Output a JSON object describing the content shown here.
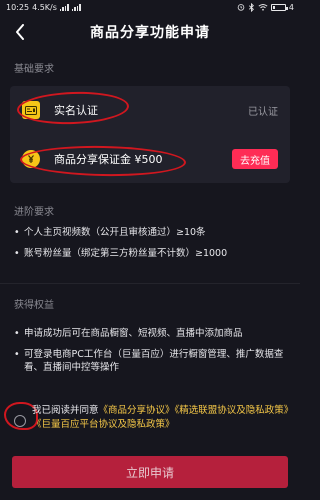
{
  "status_bar": {
    "time": "10:25",
    "network": "4.5K/s",
    "battery": "4"
  },
  "header": {
    "title": "商品分享功能申请",
    "back_icon": "chevron-left-icon"
  },
  "basic_requirements": {
    "section_label": "基础要求",
    "items": [
      {
        "label": "实名认证",
        "status": "已认证",
        "icon": "id-card-icon"
      },
      {
        "label": "商品分享保证金 ¥500",
        "action": "去充值",
        "icon": "yuan-coin-icon"
      }
    ]
  },
  "advanced_requirements": {
    "section_label": "进阶要求",
    "items": [
      "个人主页视频数（公开且审核通过）≥10条",
      "账号粉丝量（绑定第三方粉丝量不计数）≥1000"
    ]
  },
  "benefits": {
    "section_label": "获得权益",
    "items": [
      "申请成功后可在商品橱窗、短视频、直播中添加商品",
      "可登录电商PC工作台（巨量百应）进行橱窗管理、推广数据查看、直播间中控等操作"
    ]
  },
  "agreement": {
    "prefix": "我已阅读并同意",
    "link1": "《商品分享协议》",
    "link2": "《精选联盟协议及隐私政策》",
    "link3": "《巨量百应平台协议及隐私政策》"
  },
  "submit": {
    "label": "立即申请"
  },
  "colors": {
    "background": "#16161e",
    "card": "#21212b",
    "accent": "#fe2c55",
    "link": "#f7c948",
    "annotation": "#d0171f"
  }
}
